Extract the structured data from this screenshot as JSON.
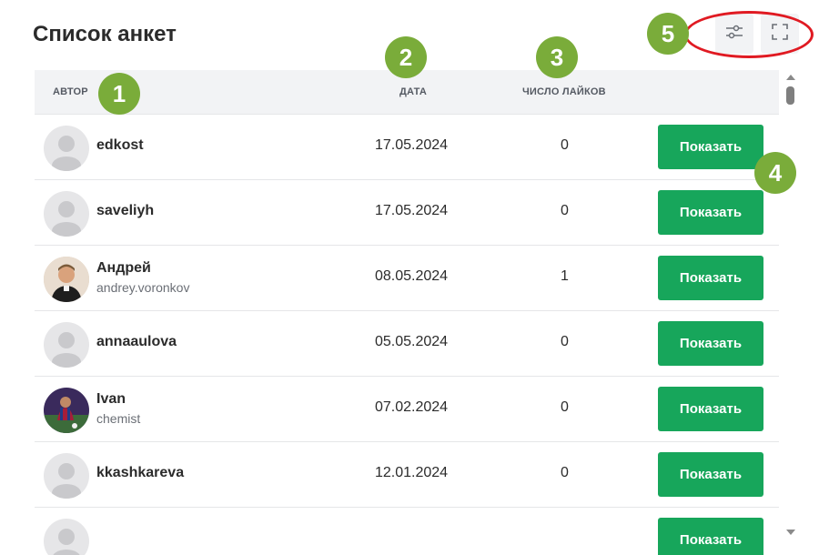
{
  "page": {
    "title": "Список анкет"
  },
  "table": {
    "columns": {
      "author": "АВТОР",
      "date": "ДАТА",
      "likes": "ЧИСЛО ЛАЙКОВ"
    },
    "rows": [
      {
        "name": "edkost",
        "login": "",
        "date": "17.05.2024",
        "likes": "0",
        "avatar": "placeholder-avatar",
        "action": "Показать"
      },
      {
        "name": "saveliyh",
        "login": "",
        "date": "17.05.2024",
        "likes": "0",
        "avatar": "placeholder-avatar",
        "action": "Показать"
      },
      {
        "name": "Андрей",
        "login": "andrey.voronkov",
        "date": "08.05.2024",
        "likes": "1",
        "avatar": "photo-avatar",
        "action": "Показать"
      },
      {
        "name": "annaaulova",
        "login": "",
        "date": "05.05.2024",
        "likes": "0",
        "avatar": "placeholder-avatar",
        "action": "Показать"
      },
      {
        "name": "Ivan",
        "login": "chemist",
        "date": "07.02.2024",
        "likes": "0",
        "avatar": "photo-avatar",
        "action": "Показать"
      },
      {
        "name": "kkashkareva",
        "login": "",
        "date": "12.01.2024",
        "likes": "0",
        "avatar": "placeholder-avatar",
        "action": "Показать"
      },
      {
        "name": "",
        "login": "",
        "date": "",
        "likes": "",
        "avatar": "placeholder-avatar",
        "action": "Показать"
      }
    ]
  },
  "toolbar": {
    "filter_icon": "sliders-icon",
    "fullscreen_icon": "fullscreen-icon"
  },
  "annotations": {
    "badges": [
      "1",
      "2",
      "3",
      "4",
      "5"
    ],
    "badge_color": "#7aac3a",
    "highlight_color": "#e01a22"
  },
  "colors": {
    "accent": "#17a65b",
    "header_bg": "#f2f3f5",
    "text": "#2b2b2b",
    "muted": "#6b6f76"
  }
}
